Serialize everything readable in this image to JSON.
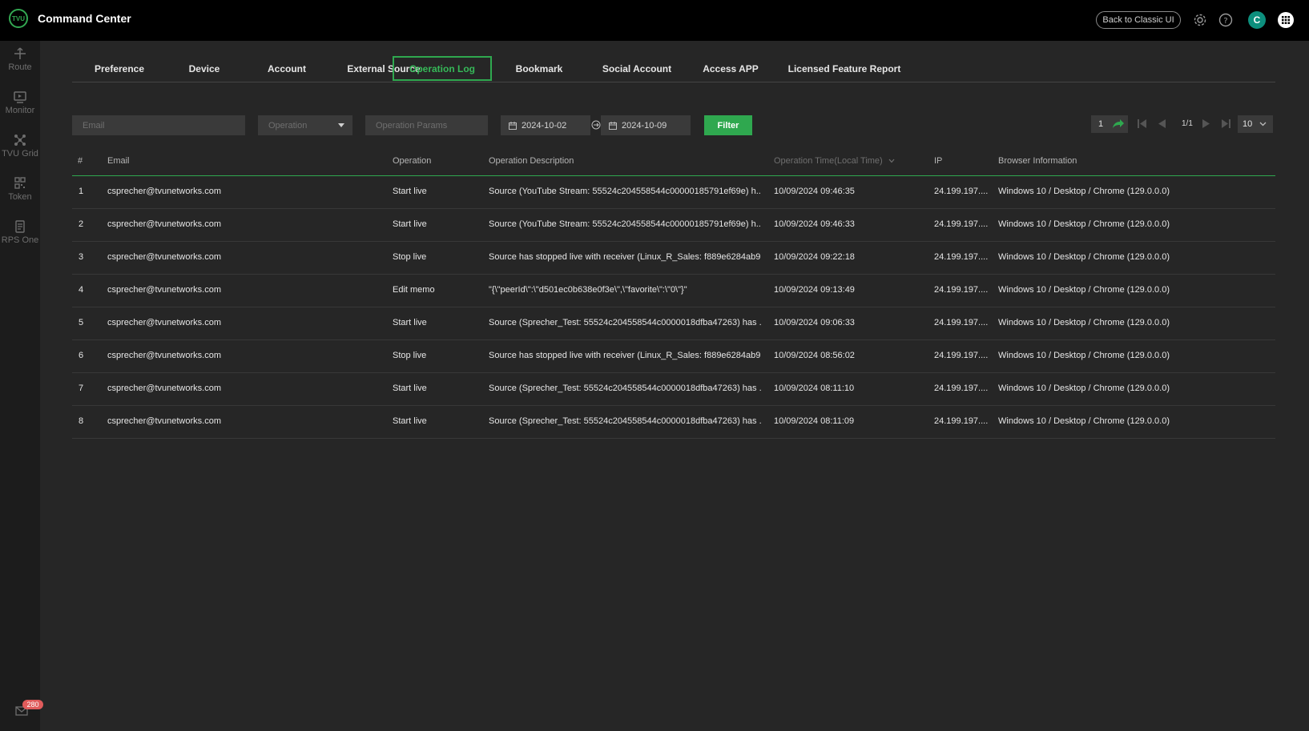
{
  "app": {
    "logo_text": "TVU",
    "title": "Command Center"
  },
  "topbar": {
    "classic_label": "Back to Classic UI",
    "avatar_initial": "C"
  },
  "sidebar": {
    "items": [
      {
        "label": "Route",
        "icon": "route-icon"
      },
      {
        "label": "Monitor",
        "icon": "monitor-icon"
      },
      {
        "label": "TVU Grid",
        "icon": "grid-network-icon"
      },
      {
        "label": "Token",
        "icon": "qr-token-icon"
      },
      {
        "label": "RPS One",
        "icon": "rps-icon"
      }
    ],
    "notification_count": "280"
  },
  "tabs": [
    {
      "label": "Preference"
    },
    {
      "label": "Device"
    },
    {
      "label": "Account"
    },
    {
      "label": "External Source"
    },
    {
      "label": "Operation Log",
      "active": true
    },
    {
      "label": "Bookmark"
    },
    {
      "label": "Social Account"
    },
    {
      "label": "Access APP"
    },
    {
      "label": "Licensed Feature Report"
    }
  ],
  "filters": {
    "email_placeholder": "Email",
    "operation_placeholder": "Operation",
    "params_placeholder": "Operation Params",
    "date_from": "2024-10-02",
    "date_to": "2024-10-09",
    "filter_label": "Filter"
  },
  "pagination": {
    "page": "1",
    "page_info": "1/1",
    "page_size": "10"
  },
  "table": {
    "headers": {
      "num": "#",
      "email": "Email",
      "operation": "Operation",
      "description": "Operation Description",
      "time": "Operation Time(Local Time)",
      "ip": "IP",
      "browser": "Browser Information"
    },
    "rows": [
      {
        "num": "1",
        "email": "csprecher@tvunetworks.com",
        "operation": "Start live",
        "description": "Source (YouTube Stream: 55524c204558544c00000185791ef69e) h...",
        "time": "10/09/2024 09:46:35",
        "ip": "24.199.197....",
        "browser": "Windows 10 / Desktop / Chrome (129.0.0.0)"
      },
      {
        "num": "2",
        "email": "csprecher@tvunetworks.com",
        "operation": "Start live",
        "description": "Source (YouTube Stream: 55524c204558544c00000185791ef69e) h...",
        "time": "10/09/2024 09:46:33",
        "ip": "24.199.197....",
        "browser": "Windows 10 / Desktop / Chrome (129.0.0.0)"
      },
      {
        "num": "3",
        "email": "csprecher@tvunetworks.com",
        "operation": "Stop live",
        "description": "Source has stopped live with receiver (Linux_R_Sales: f889e6284ab9...",
        "time": "10/09/2024 09:22:18",
        "ip": "24.199.197....",
        "browser": "Windows 10 / Desktop / Chrome (129.0.0.0)"
      },
      {
        "num": "4",
        "email": "csprecher@tvunetworks.com",
        "operation": "Edit memo",
        "description": "\"{\\\"peerId\\\":\\\"d501ec0b638e0f3e\\\",\\\"favorite\\\":\\\"0\\\"}\"",
        "time": "10/09/2024 09:13:49",
        "ip": "24.199.197....",
        "browser": "Windows 10 / Desktop / Chrome (129.0.0.0)"
      },
      {
        "num": "5",
        "email": "csprecher@tvunetworks.com",
        "operation": "Start live",
        "description": "Source (Sprecher_Test: 55524c204558544c0000018dfba47263) has ...",
        "time": "10/09/2024 09:06:33",
        "ip": "24.199.197....",
        "browser": "Windows 10 / Desktop / Chrome (129.0.0.0)"
      },
      {
        "num": "6",
        "email": "csprecher@tvunetworks.com",
        "operation": "Stop live",
        "description": "Source has stopped live with receiver (Linux_R_Sales: f889e6284ab9...",
        "time": "10/09/2024 08:56:02",
        "ip": "24.199.197....",
        "browser": "Windows 10 / Desktop / Chrome (129.0.0.0)"
      },
      {
        "num": "7",
        "email": "csprecher@tvunetworks.com",
        "operation": "Start live",
        "description": "Source (Sprecher_Test: 55524c204558544c0000018dfba47263) has ...",
        "time": "10/09/2024 08:11:10",
        "ip": "24.199.197....",
        "browser": "Windows 10 / Desktop / Chrome (129.0.0.0)"
      },
      {
        "num": "8",
        "email": "csprecher@tvunetworks.com",
        "operation": "Start live",
        "description": "Source (Sprecher_Test: 55524c204558544c0000018dfba47263) has ...",
        "time": "10/09/2024 08:11:09",
        "ip": "24.199.197....",
        "browser": "Windows 10 / Desktop / Chrome (129.0.0.0)"
      }
    ]
  },
  "colors": {
    "accent": "#2fa84f",
    "background": "#262626",
    "topbar": "#000000",
    "sidebar": "#1c1c1c",
    "badge": "#e05b5b",
    "avatar": "#0d8f7d"
  }
}
